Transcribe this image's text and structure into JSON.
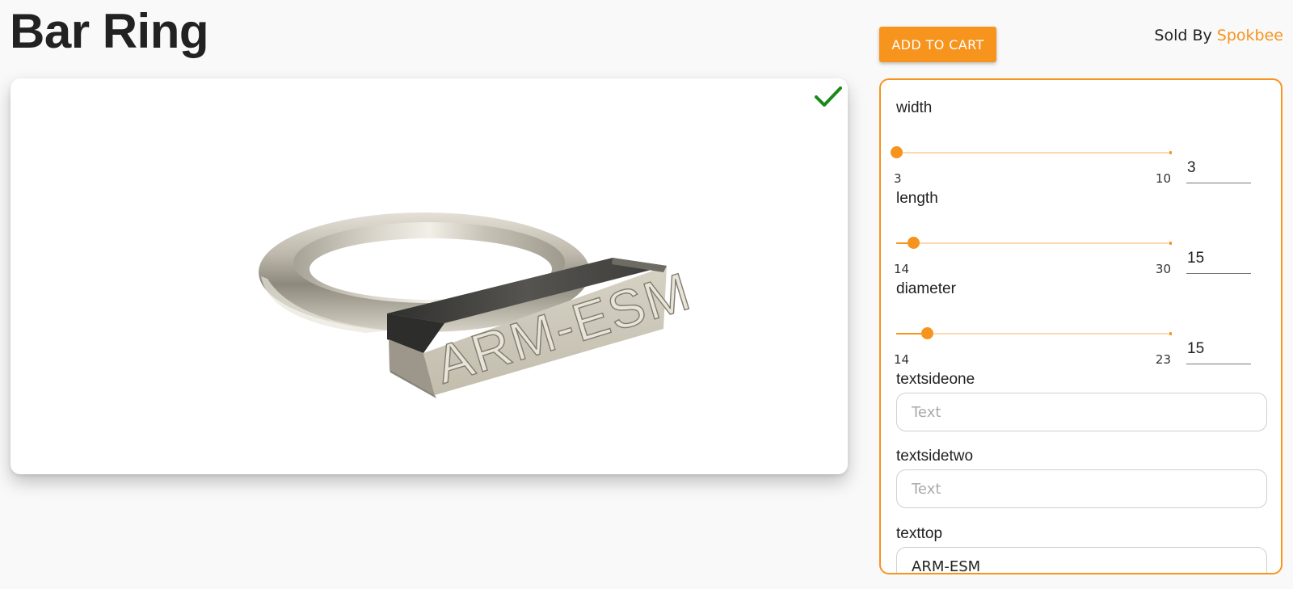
{
  "page": {
    "title": "Bar Ring"
  },
  "header": {
    "add_to_cart_label": "ADD TO CART",
    "sold_by_prefix": "Sold By",
    "seller_name": "Spokbee"
  },
  "viewer": {
    "status_icon": "check-icon",
    "engraving_text": "ARM-ESM",
    "status_color": "#1a8a1a"
  },
  "params": {
    "width": {
      "label": "width",
      "min": "3",
      "max": "10",
      "value": "3",
      "fraction": 0.0
    },
    "length": {
      "label": "length",
      "min": "14",
      "max": "30",
      "value": "15",
      "fraction": 0.0625
    },
    "diameter": {
      "label": "diameter",
      "min": "14",
      "max": "23",
      "value": "15",
      "fraction": 0.111
    }
  },
  "text_params": {
    "textsideone": {
      "label": "textsideone",
      "placeholder": "Text",
      "value": ""
    },
    "textsidetwo": {
      "label": "textsidetwo",
      "placeholder": "Text",
      "value": ""
    },
    "texttop": {
      "label": "texttop",
      "placeholder": "Text",
      "value": "ARM-ESM"
    }
  },
  "colors": {
    "accent": "#f7941e",
    "accent_light": "#fcd9b0"
  }
}
